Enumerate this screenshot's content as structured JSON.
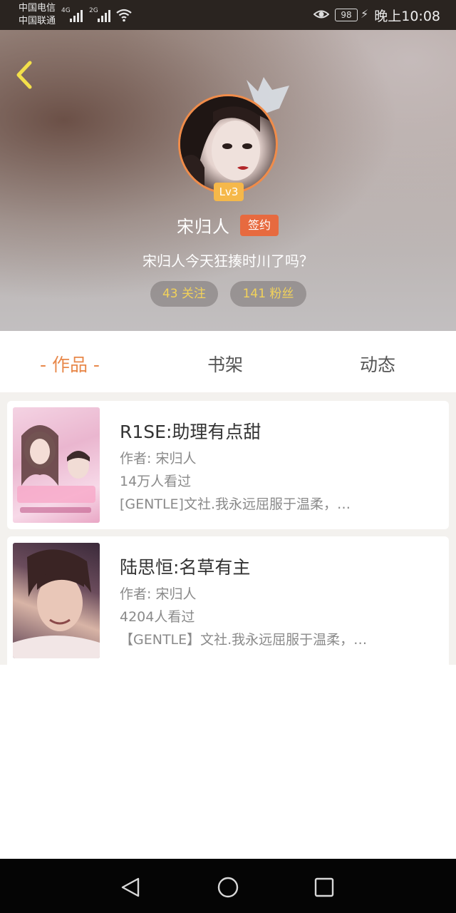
{
  "status_bar": {
    "carrier_1": "中国电信",
    "carrier_2": "中国联通",
    "network_1": "4G",
    "network_2": "2G",
    "battery": "98",
    "time": "晚上10:08"
  },
  "profile": {
    "level": "Lv3",
    "name": "宋归人",
    "sign_badge": "签约",
    "motto": "宋归人今天狂揍时川了吗？",
    "follow": "43 关注",
    "fans": "141 粉丝"
  },
  "tabs": {
    "works": "- 作品 -",
    "shelf": "书架",
    "feed": "动态"
  },
  "books": [
    {
      "title": "R1SE:助理有点甜",
      "author": "作者: 宋归人",
      "views": "14万人看过",
      "desc": "[GENTLE]文社.我永远屈服于温柔，…"
    },
    {
      "title": "陆思恒:名草有主",
      "author": "作者: 宋归人",
      "views": "4204人看过",
      "desc": "【GENTLE】文社.我永远屈服于温柔，…"
    }
  ],
  "colors": {
    "accent": "#e8884a",
    "sign_badge": "#e76a3f",
    "level_badge": "#f5b84a",
    "pill_text": "#f2d25a"
  }
}
